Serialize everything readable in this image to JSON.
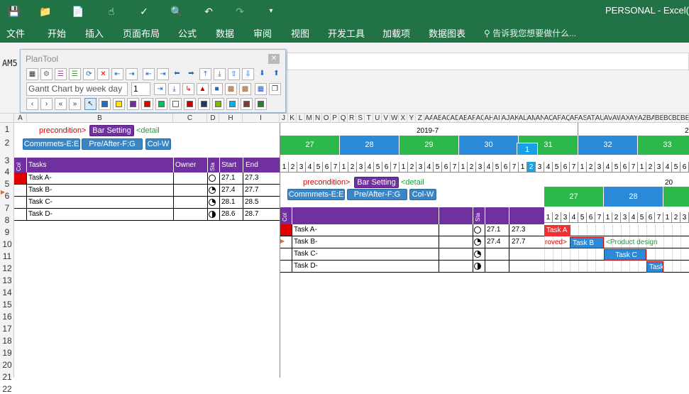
{
  "app": {
    "title": "PERSONAL - Excel("
  },
  "ribbon": {
    "tabs": [
      "文件",
      "开始",
      "插入",
      "页面布局",
      "公式",
      "数据",
      "审阅",
      "视图",
      "开发工具",
      "加载项",
      "数据图表"
    ],
    "tell_me": "告诉我您想要做什么..."
  },
  "name_box": "AM5",
  "plantool": {
    "title": "PlanTool",
    "combo_value": "Gantt Chart by week day",
    "num_value": "1",
    "swatches": [
      "#1f6fc4",
      "#ffe400",
      "#7030a0",
      "#e00000",
      "#00c060",
      "#ffffff",
      "#c00000",
      "#1f3864",
      "#7fb800",
      "#00b0f0",
      "#7a3b3b",
      "#2e7d32"
    ]
  },
  "columns_left": [
    "A",
    "B",
    "C",
    "D",
    "H",
    "I"
  ],
  "columns_right": [
    "J",
    "K",
    "L",
    "M",
    "N",
    "O",
    "P",
    "Q",
    "R",
    "S",
    "T",
    "U",
    "V",
    "W",
    "X",
    "Y",
    "Z",
    "AA",
    "AB",
    "AC",
    "AD",
    "AE",
    "AF",
    "AG",
    "AH",
    "AI",
    "AJ",
    "AK",
    "AL",
    "AM",
    "AN",
    "AO",
    "AP",
    "AQ",
    "AR",
    "AS",
    "AT",
    "AU",
    "AV",
    "AW",
    "AX",
    "AY",
    "AZ",
    "BA",
    "BB",
    "BC",
    "BD",
    "BE"
  ],
  "rows": [
    "1",
    "2",
    "3",
    "4",
    "5",
    "6",
    "7",
    "8",
    "9",
    "10",
    "11",
    "12",
    "13",
    "14",
    "15",
    "16",
    "17",
    "18",
    "19",
    "20",
    "21",
    "22"
  ],
  "sheet": {
    "precondition": "precondition>",
    "bar_setting": "Bar Setting",
    "detail": "<detail",
    "btn_comments": "Commmets-E:E",
    "btn_prepost": "Pre/After-F:G",
    "btn_colw": "Col-W",
    "header": {
      "col": "Col",
      "tasks": "Tasks",
      "owner": "Owner",
      "status": "Sta",
      "start": "Start",
      "end": "End"
    },
    "tasks": [
      {
        "name": "Task A-",
        "start": "27.1",
        "end": "27.3"
      },
      {
        "name": "Task B-",
        "start": "27.4",
        "end": "27.7"
      },
      {
        "name": "Task C-",
        "start": "28.1",
        "end": "28.5"
      },
      {
        "name": "Task D-",
        "start": "28.6",
        "end": "28.7"
      }
    ],
    "month_label": "2019-7",
    "month_label_2": "2",
    "weeks": [
      "27",
      "28",
      "29",
      "30",
      "31",
      "32",
      "33"
    ],
    "highlight_day": "1",
    "days": [
      "1",
      "2",
      "3",
      "4",
      "5",
      "6",
      "7"
    ]
  },
  "overlay": {
    "precondition": "precondition>",
    "bar_setting": "Bar Setting",
    "detail": "<detail",
    "btn_comments": "Commmets-E:E",
    "btn_prepost": "Pre/After-F:G",
    "btn_colw": "Col-W",
    "status": "Sta",
    "col": "Col",
    "month_label": "20",
    "weeks": [
      "27",
      "28"
    ],
    "tasks": [
      {
        "name": "Task A-",
        "start": "27.1",
        "end": "27.3"
      },
      {
        "name": "Task B-",
        "start": "27.4",
        "end": "27.7"
      },
      {
        "name": "Task C-",
        "start": "",
        "end": ""
      },
      {
        "name": "Task D-",
        "start": "",
        "end": ""
      }
    ],
    "bars": [
      {
        "label": "Task A"
      },
      {
        "label": "Task B",
        "left_note": "roved>",
        "right_note": "<Product design"
      },
      {
        "label": "Task C"
      },
      {
        "label": "Task D"
      }
    ]
  },
  "colors": {
    "excel_green": "#217346",
    "week_green": "#2db84c",
    "week_blue": "#2a8ad8",
    "header_purple": "#7030a0",
    "bar_red": "#f03030",
    "bar_blue": "#2a8ad8"
  }
}
